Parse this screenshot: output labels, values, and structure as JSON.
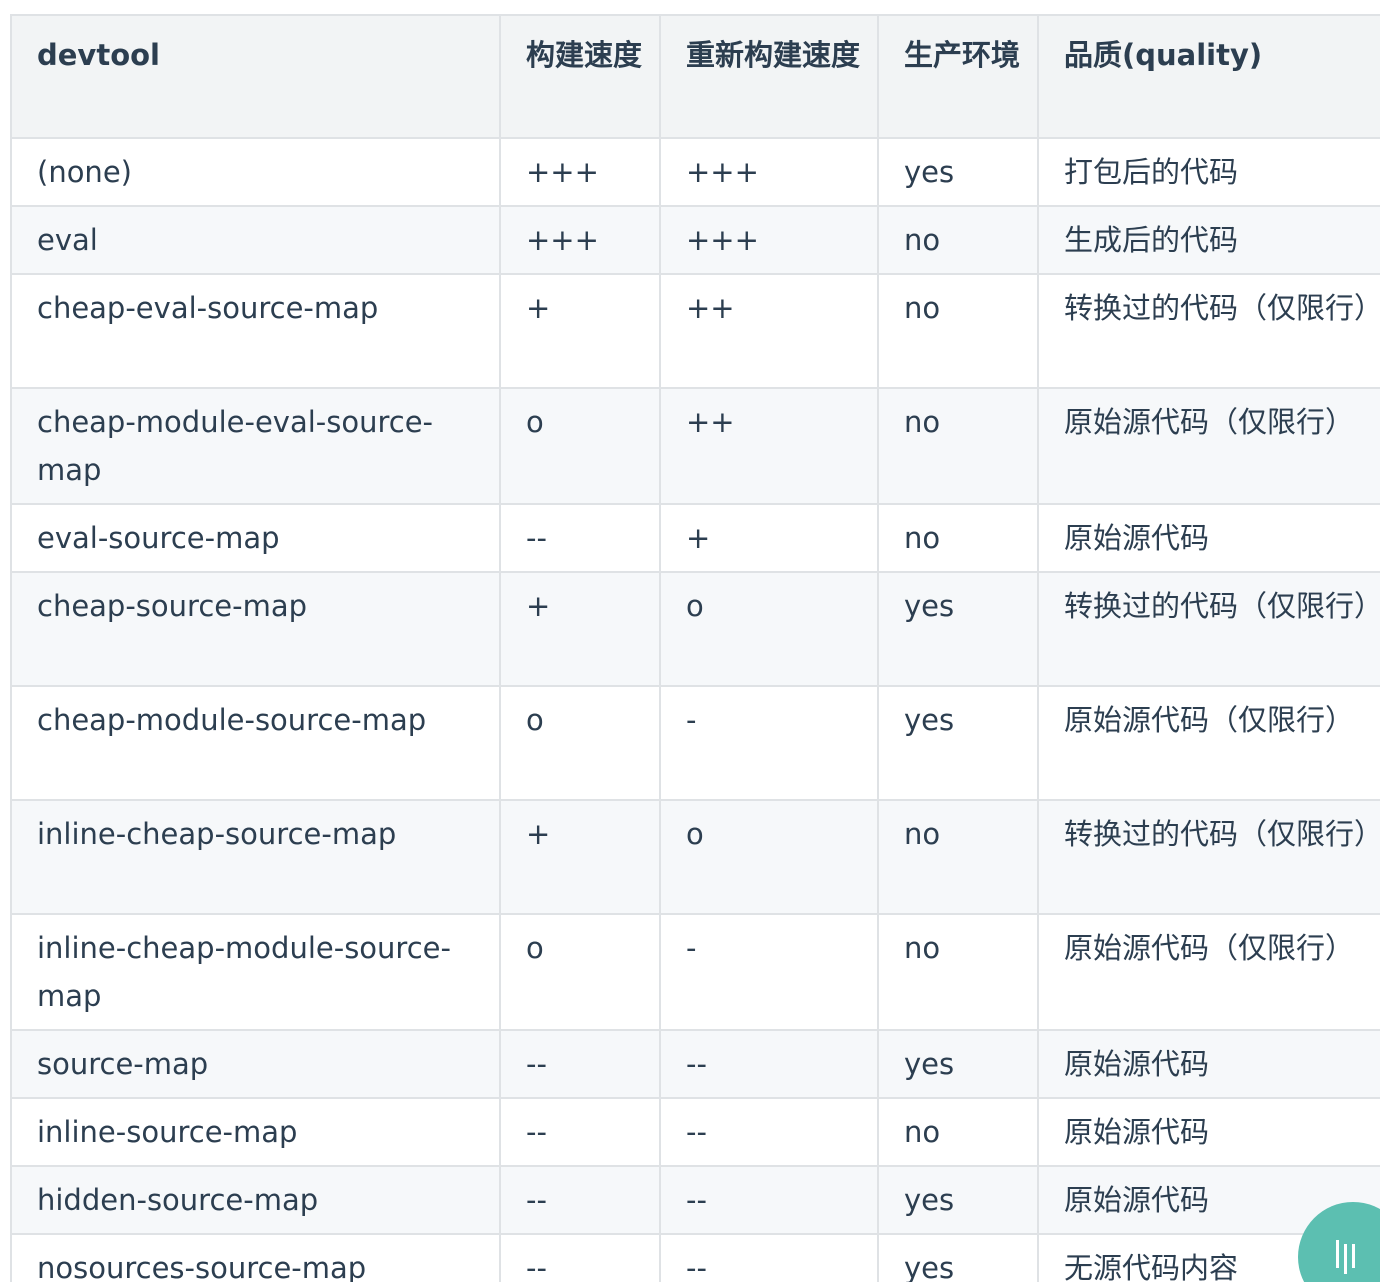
{
  "table": {
    "headers": {
      "devtool": "devtool",
      "build": "构建速度",
      "rebuild": "重新构建速度",
      "production": "生产环境",
      "quality": "品质(quality)"
    },
    "rows": [
      {
        "devtool": "(none)",
        "build": "+++",
        "rebuild": "+++",
        "production": "yes",
        "quality": "打包后的代码"
      },
      {
        "devtool": "eval",
        "build": "+++",
        "rebuild": "+++",
        "production": "no",
        "quality": "生成后的代码"
      },
      {
        "devtool": "cheap-eval-source-map",
        "build": "+",
        "rebuild": "++",
        "production": "no",
        "quality": "转换过的代码（仅限行）"
      },
      {
        "devtool": "cheap-module-eval-source-map",
        "build": "o",
        "rebuild": "++",
        "production": "no",
        "quality": "原始源代码（仅限行）"
      },
      {
        "devtool": "eval-source-map",
        "build": "--",
        "rebuild": "+",
        "production": "no",
        "quality": "原始源代码"
      },
      {
        "devtool": "cheap-source-map",
        "build": "+",
        "rebuild": "o",
        "production": "yes",
        "quality": "转换过的代码（仅限行）"
      },
      {
        "devtool": "cheap-module-source-map",
        "build": "o",
        "rebuild": "-",
        "production": "yes",
        "quality": "原始源代码（仅限行）"
      },
      {
        "devtool": "inline-cheap-source-map",
        "build": "+",
        "rebuild": "o",
        "production": "no",
        "quality": "转换过的代码（仅限行）"
      },
      {
        "devtool": "inline-cheap-module-source-map",
        "build": "o",
        "rebuild": "-",
        "production": "no",
        "quality": "原始源代码（仅限行）"
      },
      {
        "devtool": "source-map",
        "build": "--",
        "rebuild": "--",
        "production": "yes",
        "quality": "原始源代码"
      },
      {
        "devtool": "inline-source-map",
        "build": "--",
        "rebuild": "--",
        "production": "no",
        "quality": "原始源代码"
      },
      {
        "devtool": "hidden-source-map",
        "build": "--",
        "rebuild": "--",
        "production": "yes",
        "quality": "原始源代码"
      },
      {
        "devtool": "nosources-source-map",
        "build": "--",
        "rebuild": "--",
        "production": "yes",
        "quality": "无源代码内容"
      }
    ]
  },
  "floating_button": {
    "icon": "bars-icon",
    "color": "#5cbfb1"
  }
}
